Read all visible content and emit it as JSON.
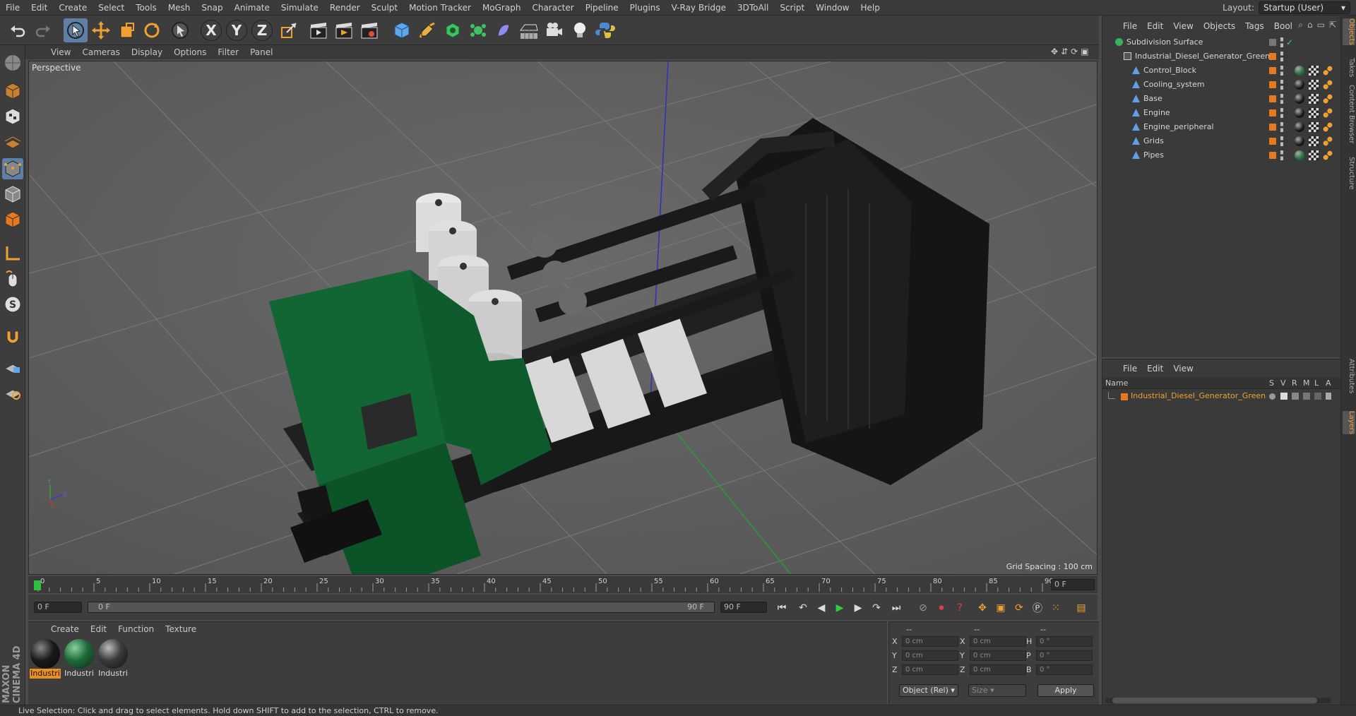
{
  "menubar": {
    "items": [
      "File",
      "Edit",
      "Create",
      "Select",
      "Tools",
      "Mesh",
      "Snap",
      "Animate",
      "Simulate",
      "Render",
      "Sculpt",
      "Motion Tracker",
      "MoGraph",
      "Character",
      "Pipeline",
      "Plugins",
      "V-Ray Bridge",
      "3DToAll",
      "Script",
      "Window",
      "Help"
    ],
    "layout_label": "Layout:",
    "layout_value": "Startup (User)"
  },
  "toolbar": {
    "axis_x": "X",
    "axis_y": "Y",
    "axis_z": "Z"
  },
  "viewport": {
    "menu": [
      "View",
      "Cameras",
      "Display",
      "Options",
      "Filter",
      "Panel"
    ],
    "label": "Perspective",
    "grid_spacing": "Grid Spacing : 100 cm",
    "gizmo_y": "Y",
    "gizmo_z": "Z"
  },
  "timeline": {
    "ticks": [
      "0",
      "5",
      "10",
      "15",
      "20",
      "25",
      "30",
      "35",
      "40",
      "45",
      "50",
      "55",
      "60",
      "65",
      "70",
      "75",
      "80",
      "85",
      "90"
    ],
    "current_frame": "0 F",
    "end_field": "0 F"
  },
  "timectl": {
    "start": "0 F",
    "range_left": "0 F",
    "range_right": "90 F",
    "end": "90 F"
  },
  "materials": {
    "menu": [
      "Create",
      "Edit",
      "Function",
      "Texture"
    ],
    "items": [
      {
        "label": "Industri",
        "color": "#1a1a1a"
      },
      {
        "label": "Industri",
        "color": "#1f6a3a"
      },
      {
        "label": "Industri",
        "color": "#3a3a3a"
      }
    ]
  },
  "coords": {
    "header_a": "--",
    "header_b": "--",
    "header_c": "--",
    "rows": [
      {
        "a": "X",
        "av": "0 cm",
        "b": "X",
        "bv": "0 cm",
        "c": "H",
        "cv": "0 °"
      },
      {
        "a": "Y",
        "av": "0 cm",
        "b": "Y",
        "bv": "0 cm",
        "c": "P",
        "cv": "0 °"
      },
      {
        "a": "Z",
        "av": "0 cm",
        "b": "Z",
        "bv": "0 cm",
        "c": "B",
        "cv": "0 °"
      }
    ],
    "mode": "Object (Rel)",
    "size": "Size",
    "apply": "Apply"
  },
  "objects": {
    "menu": [
      "File",
      "Edit",
      "View",
      "Objects",
      "Tags",
      "Bool"
    ],
    "rows": [
      {
        "name": "Subdivision Surface",
        "indent": 0
      },
      {
        "name": "Industrial_Diesel_Generator_Green",
        "indent": 1
      },
      {
        "name": "Control_Block",
        "indent": 2
      },
      {
        "name": "Cooling_system",
        "indent": 2
      },
      {
        "name": "Base",
        "indent": 2
      },
      {
        "name": "Engine",
        "indent": 2
      },
      {
        "name": "Engine_peripheral",
        "indent": 2
      },
      {
        "name": "Grids",
        "indent": 2
      },
      {
        "name": "Pipes",
        "indent": 2
      }
    ]
  },
  "layers": {
    "menu": [
      "File",
      "Edit",
      "View"
    ],
    "col_name": "Name",
    "cols": [
      "S",
      "V",
      "R",
      "M",
      "L",
      "A"
    ],
    "row": "Industrial_Diesel_Generator_Green"
  },
  "sidetabs": [
    "Objects",
    "Takes",
    "Content Browser",
    "Structure",
    "Attributes",
    "Layers"
  ],
  "status": "Live Selection: Click and drag to select elements. Hold down SHIFT to add to the selection, CTRL to remove.",
  "brand": "MAXON CINEMA 4D",
  "colors": {
    "accent": "#5f7fa6",
    "orange": "#e8791f",
    "layer_text": "#f0a030"
  }
}
